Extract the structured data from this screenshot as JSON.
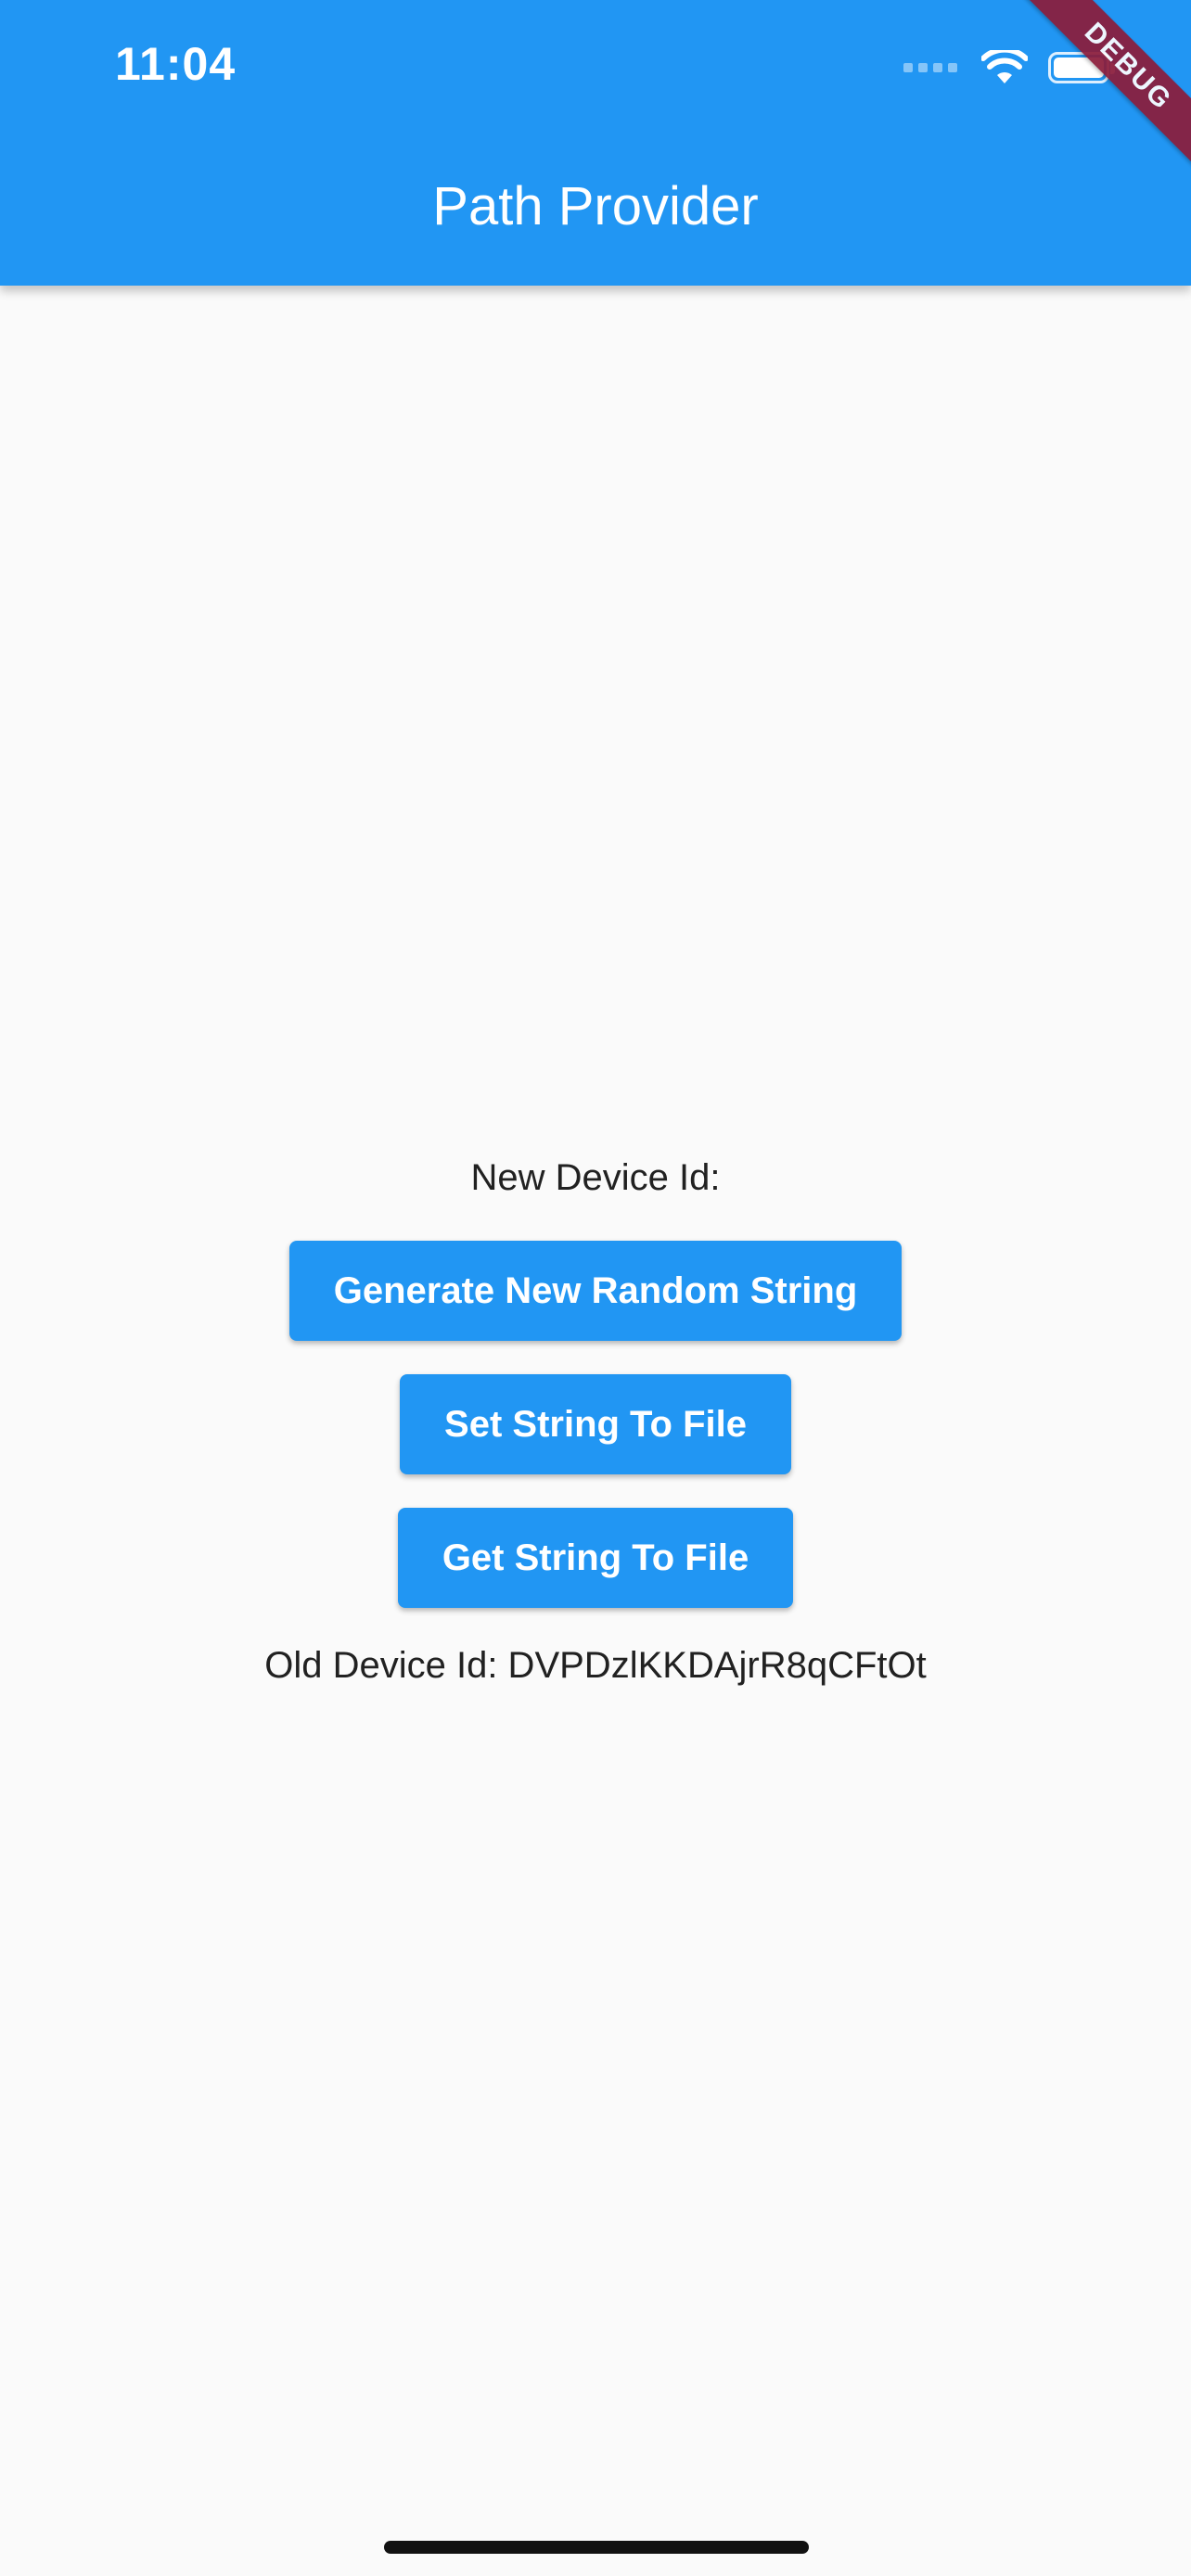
{
  "status_bar": {
    "time": "11:04",
    "icons": [
      "cellular-signal-icon",
      "wifi-icon",
      "battery-icon"
    ]
  },
  "app_bar": {
    "title": "Path Provider",
    "color": "#2196f3"
  },
  "debug_banner": {
    "label": "DEBUG",
    "color": "#8c1c3a"
  },
  "main": {
    "new_device_label": "New Device Id:",
    "buttons": {
      "generate": "Generate New Random String",
      "set": "Set String To File",
      "get": "Get String To File"
    },
    "old_device_label": "Old Device Id: DVPDzlKKDAjrR8qCFtOt"
  }
}
